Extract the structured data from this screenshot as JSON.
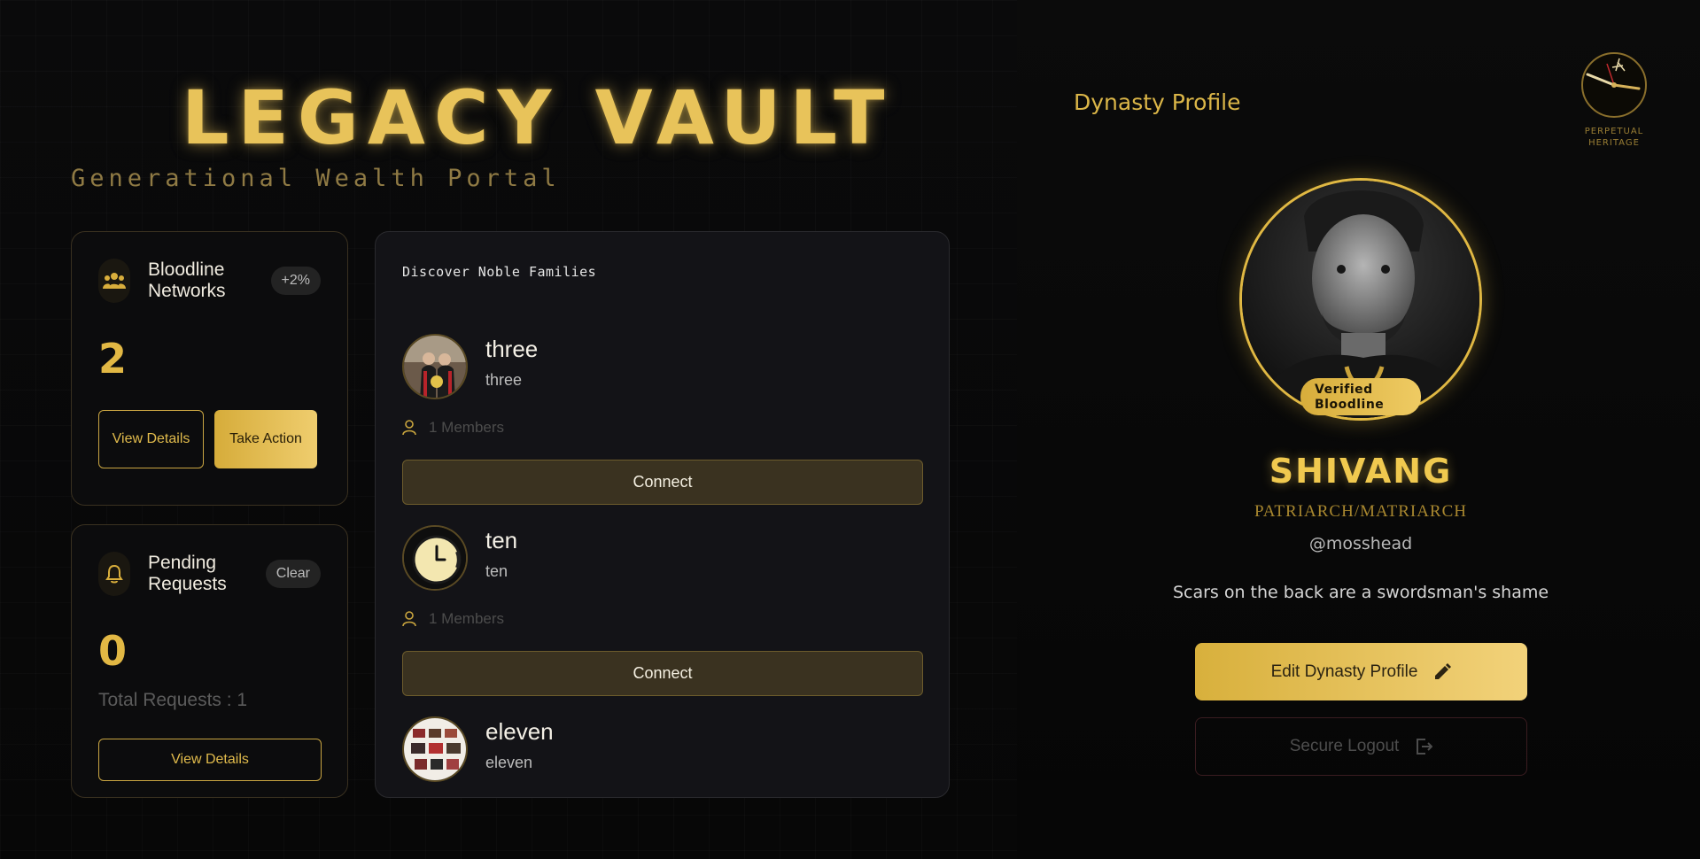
{
  "header": {
    "title": "LEGACY VAULT",
    "subtitle": "Generational Wealth Portal"
  },
  "bloodline_card": {
    "title": "Bloodline Networks",
    "badge": "+2%",
    "count": "2",
    "view_label": "View Details",
    "action_label": "Take Action",
    "icon": "people-icon"
  },
  "pending_card": {
    "title": "Pending Requests",
    "badge": "Clear",
    "count": "0",
    "total_text": "Total Requests : 1",
    "view_label": "View Details",
    "icon": "bell-icon"
  },
  "discover": {
    "title": "Discover Noble Families",
    "families": [
      {
        "name": "three",
        "subtitle": "three",
        "members": "1 Members",
        "connect_label": "Connect"
      },
      {
        "name": "ten",
        "subtitle": "ten",
        "members": "1 Members",
        "connect_label": "Connect"
      },
      {
        "name": "eleven",
        "subtitle": "eleven"
      }
    ]
  },
  "profile": {
    "heading": "Dynasty Profile",
    "emblem_caption": "PERPETUAL HERITAGE",
    "verified_badge": "Verified Bloodline",
    "name": "SHIVANG",
    "role": "PATRIARCH/MATRIARCH",
    "handle": "@mosshead",
    "bio": "Scars on the back are a swordsman's shame",
    "edit_label": "Edit Dynasty Profile",
    "logout_label": "Secure Logout"
  },
  "colors": {
    "gold": "#e2b844",
    "background": "#050505",
    "panel": "#131317"
  }
}
